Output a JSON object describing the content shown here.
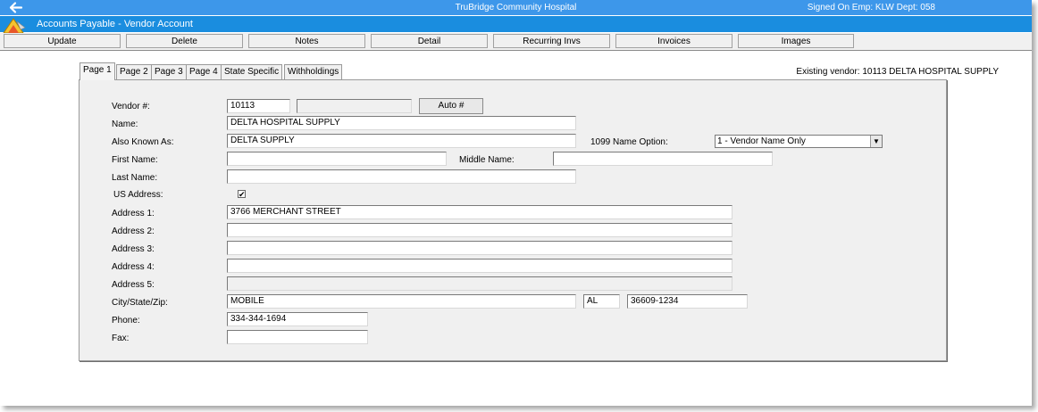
{
  "titlebar": {
    "hospital": "TruBridge Community Hospital",
    "signed_on": "Signed On Emp: KLW  Dept: 058"
  },
  "window_title": "Accounts Payable - Vendor Account",
  "toolbar": [
    "Update",
    "Delete",
    "Notes",
    "Detail",
    "Recurring Invs",
    "Invoices",
    "Images"
  ],
  "tabs": [
    "Page 1",
    "Page 2",
    "Page 3",
    "Page 4",
    "State Specific",
    "Withholdings"
  ],
  "active_tab": "Page 1",
  "existing_vendor": "Existing vendor: 10113  DELTA HOSPITAL SUPPLY",
  "form": {
    "vendor_label": "Vendor #:",
    "vendor_value": "10113",
    "auto_button": "Auto #",
    "name_label": "Name:",
    "name_value": "DELTA HOSPITAL SUPPLY",
    "aka_label": "Also Known As:",
    "aka_value": "DELTA SUPPLY",
    "name_option_label": "1099 Name Option:",
    "name_option_value": "1 - Vendor Name Only",
    "first_name_label": "First Name:",
    "middle_name_label": "Middle Name:",
    "last_name_label": "Last Name:",
    "us_address_label": "US Address:",
    "us_address_checked": "✔",
    "address1_label": "Address 1:",
    "address1_value": "3766 MERCHANT STREET",
    "address2_label": "Address 2:",
    "address3_label": "Address 3:",
    "address4_label": "Address 4:",
    "address5_label": "Address 5:",
    "csz_label": "City/State/Zip:",
    "city_value": "MOBILE",
    "state_value": "AL",
    "zip_value": "36609-1234",
    "phone_label": "Phone:",
    "phone_value": "334-344-1694",
    "fax_label": "Fax:"
  },
  "colors": {
    "titlebar": "#3d97ea",
    "subbar": "#1a8ddf",
    "panel": "#f0f0f0"
  },
  "icons": {
    "back": "back-arrow-icon",
    "logo": "app-logo-icon",
    "dropdown": "chevron-down-icon",
    "checkbox": "checkmark-icon"
  }
}
